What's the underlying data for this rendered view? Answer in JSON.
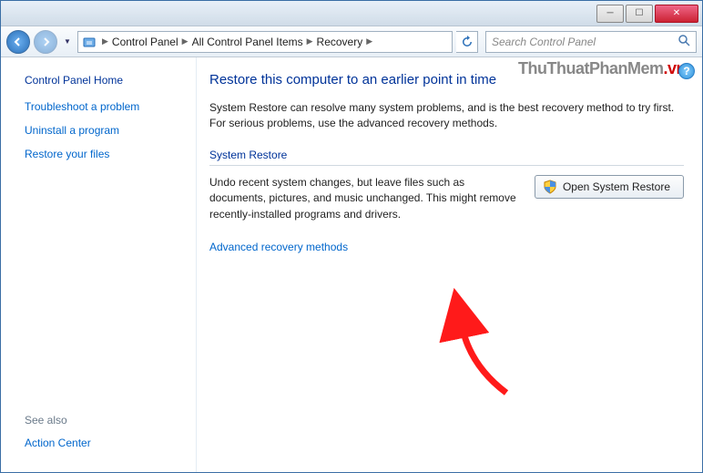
{
  "watermark": {
    "a": "ThuThuatPhanMem",
    "b": ".vn"
  },
  "breadcrumb": {
    "items": [
      "Control Panel",
      "All Control Panel Items",
      "Recovery"
    ]
  },
  "search": {
    "placeholder": "Search Control Panel"
  },
  "sidebar": {
    "home": "Control Panel Home",
    "links": {
      "troubleshoot": "Troubleshoot a problem",
      "uninstall": "Uninstall a program",
      "restore_files": "Restore your files"
    },
    "see_also_label": "See also",
    "see_also": {
      "action_center": "Action Center"
    }
  },
  "main": {
    "title": "Restore this computer to an earlier point in time",
    "intro": "System Restore can resolve many system problems, and is the best recovery method to try first. For serious problems, use the advanced recovery methods.",
    "section_title": "System Restore",
    "restore_desc": "Undo recent system changes, but leave files such as documents, pictures, and music unchanged. This might remove recently-installed programs and drivers.",
    "open_button": "Open System Restore",
    "advanced_link": "Advanced recovery methods"
  }
}
